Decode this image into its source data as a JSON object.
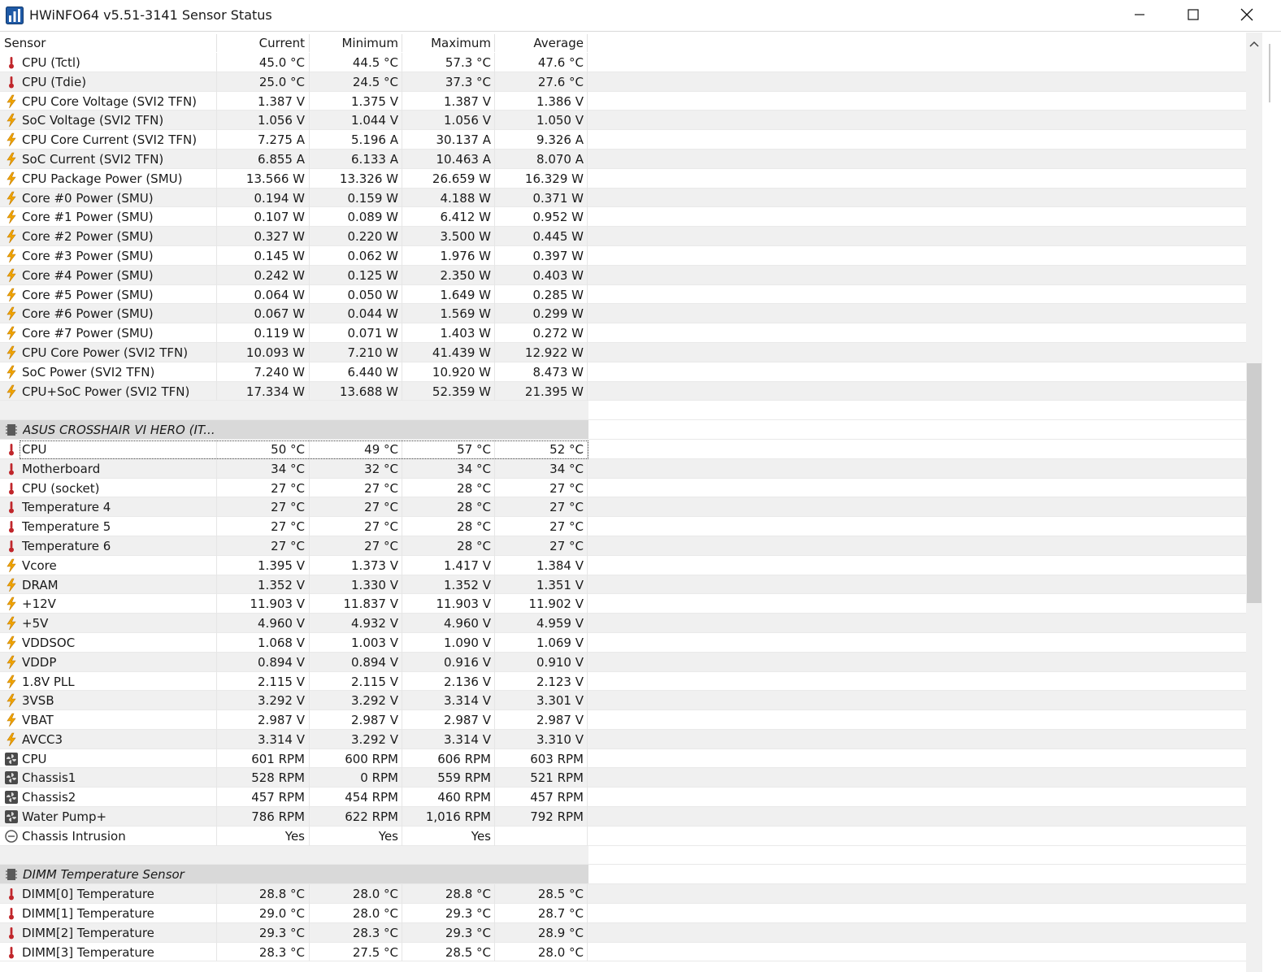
{
  "window": {
    "title": "HWiNFO64 v5.51-3141 Sensor Status",
    "app_icon": "hwinfo-chart-icon",
    "controls": [
      "minimize-icon",
      "maximize-icon",
      "close-icon"
    ]
  },
  "columns": {
    "sensor": "Sensor",
    "current": "Current",
    "minimum": "Minimum",
    "maximum": "Maximum",
    "average": "Average"
  },
  "icons": {
    "temp": {
      "name": "thermometer-icon",
      "color": "#c0262b"
    },
    "volt": {
      "name": "lightning-icon",
      "color": "#f0a400"
    },
    "fan": {
      "name": "fan-icon",
      "color": "#3c3c3c"
    },
    "other": {
      "name": "intrusion-icon",
      "color": "#555555"
    },
    "chip": {
      "name": "chip-icon",
      "color": "#555555"
    }
  },
  "rows": [
    {
      "type": "sensor",
      "icon": "temp",
      "name": "CPU (Tctl)",
      "current": "45.0 °C",
      "minimum": "44.5 °C",
      "maximum": "57.3 °C",
      "average": "47.6 °C"
    },
    {
      "type": "sensor",
      "icon": "temp",
      "name": "CPU (Tdie)",
      "current": "25.0 °C",
      "minimum": "24.5 °C",
      "maximum": "37.3 °C",
      "average": "27.6 °C"
    },
    {
      "type": "sensor",
      "icon": "volt",
      "name": "CPU Core Voltage (SVI2 TFN)",
      "current": "1.387 V",
      "minimum": "1.375 V",
      "maximum": "1.387 V",
      "average": "1.386 V"
    },
    {
      "type": "sensor",
      "icon": "volt",
      "name": "SoC Voltage (SVI2 TFN)",
      "current": "1.056 V",
      "minimum": "1.044 V",
      "maximum": "1.056 V",
      "average": "1.050 V"
    },
    {
      "type": "sensor",
      "icon": "volt",
      "name": "CPU Core Current (SVI2 TFN)",
      "current": "7.275 A",
      "minimum": "5.196 A",
      "maximum": "30.137 A",
      "average": "9.326 A"
    },
    {
      "type": "sensor",
      "icon": "volt",
      "name": "SoC Current (SVI2 TFN)",
      "current": "6.855 A",
      "minimum": "6.133 A",
      "maximum": "10.463 A",
      "average": "8.070 A"
    },
    {
      "type": "sensor",
      "icon": "volt",
      "name": "CPU Package Power (SMU)",
      "current": "13.566 W",
      "minimum": "13.326 W",
      "maximum": "26.659 W",
      "average": "16.329 W"
    },
    {
      "type": "sensor",
      "icon": "volt",
      "name": "Core #0 Power (SMU)",
      "current": "0.194 W",
      "minimum": "0.159 W",
      "maximum": "4.188 W",
      "average": "0.371 W"
    },
    {
      "type": "sensor",
      "icon": "volt",
      "name": "Core #1 Power (SMU)",
      "current": "0.107 W",
      "minimum": "0.089 W",
      "maximum": "6.412 W",
      "average": "0.952 W"
    },
    {
      "type": "sensor",
      "icon": "volt",
      "name": "Core #2 Power (SMU)",
      "current": "0.327 W",
      "minimum": "0.220 W",
      "maximum": "3.500 W",
      "average": "0.445 W"
    },
    {
      "type": "sensor",
      "icon": "volt",
      "name": "Core #3 Power (SMU)",
      "current": "0.145 W",
      "minimum": "0.062 W",
      "maximum": "1.976 W",
      "average": "0.397 W"
    },
    {
      "type": "sensor",
      "icon": "volt",
      "name": "Core #4 Power (SMU)",
      "current": "0.242 W",
      "minimum": "0.125 W",
      "maximum": "2.350 W",
      "average": "0.403 W"
    },
    {
      "type": "sensor",
      "icon": "volt",
      "name": "Core #5 Power (SMU)",
      "current": "0.064 W",
      "minimum": "0.050 W",
      "maximum": "1.649 W",
      "average": "0.285 W"
    },
    {
      "type": "sensor",
      "icon": "volt",
      "name": "Core #6 Power (SMU)",
      "current": "0.067 W",
      "minimum": "0.044 W",
      "maximum": "1.569 W",
      "average": "0.299 W"
    },
    {
      "type": "sensor",
      "icon": "volt",
      "name": "Core #7 Power (SMU)",
      "current": "0.119 W",
      "minimum": "0.071 W",
      "maximum": "1.403 W",
      "average": "0.272 W"
    },
    {
      "type": "sensor",
      "icon": "volt",
      "name": "CPU Core Power (SVI2 TFN)",
      "current": "10.093 W",
      "minimum": "7.210 W",
      "maximum": "41.439 W",
      "average": "12.922 W"
    },
    {
      "type": "sensor",
      "icon": "volt",
      "name": "SoC Power (SVI2 TFN)",
      "current": "7.240 W",
      "minimum": "6.440 W",
      "maximum": "10.920 W",
      "average": "8.473 W"
    },
    {
      "type": "sensor",
      "icon": "volt",
      "name": "CPU+SoC Power (SVI2 TFN)",
      "current": "17.334 W",
      "minimum": "13.688 W",
      "maximum": "52.359 W",
      "average": "21.395 W"
    },
    {
      "type": "blank"
    },
    {
      "type": "group",
      "icon": "chip",
      "name": "ASUS CROSSHAIR VI HERO (IT..."
    },
    {
      "type": "sensor",
      "icon": "temp",
      "name": "CPU",
      "current": "50 °C",
      "minimum": "49 °C",
      "maximum": "57 °C",
      "average": "52 °C",
      "focused": true
    },
    {
      "type": "sensor",
      "icon": "temp",
      "name": "Motherboard",
      "current": "34 °C",
      "minimum": "32 °C",
      "maximum": "34 °C",
      "average": "34 °C"
    },
    {
      "type": "sensor",
      "icon": "temp",
      "name": "CPU (socket)",
      "current": "27 °C",
      "minimum": "27 °C",
      "maximum": "28 °C",
      "average": "27 °C"
    },
    {
      "type": "sensor",
      "icon": "temp",
      "name": "Temperature 4",
      "current": "27 °C",
      "minimum": "27 °C",
      "maximum": "28 °C",
      "average": "27 °C"
    },
    {
      "type": "sensor",
      "icon": "temp",
      "name": "Temperature 5",
      "current": "27 °C",
      "minimum": "27 °C",
      "maximum": "28 °C",
      "average": "27 °C"
    },
    {
      "type": "sensor",
      "icon": "temp",
      "name": "Temperature 6",
      "current": "27 °C",
      "minimum": "27 °C",
      "maximum": "28 °C",
      "average": "27 °C"
    },
    {
      "type": "sensor",
      "icon": "volt",
      "name": "Vcore",
      "current": "1.395 V",
      "minimum": "1.373 V",
      "maximum": "1.417 V",
      "average": "1.384 V"
    },
    {
      "type": "sensor",
      "icon": "volt",
      "name": "DRAM",
      "current": "1.352 V",
      "minimum": "1.330 V",
      "maximum": "1.352 V",
      "average": "1.351 V"
    },
    {
      "type": "sensor",
      "icon": "volt",
      "name": "+12V",
      "current": "11.903 V",
      "minimum": "11.837 V",
      "maximum": "11.903 V",
      "average": "11.902 V"
    },
    {
      "type": "sensor",
      "icon": "volt",
      "name": "+5V",
      "current": "4.960 V",
      "minimum": "4.932 V",
      "maximum": "4.960 V",
      "average": "4.959 V"
    },
    {
      "type": "sensor",
      "icon": "volt",
      "name": "VDDSOC",
      "current": "1.068 V",
      "minimum": "1.003 V",
      "maximum": "1.090 V",
      "average": "1.069 V"
    },
    {
      "type": "sensor",
      "icon": "volt",
      "name": "VDDP",
      "current": "0.894 V",
      "minimum": "0.894 V",
      "maximum": "0.916 V",
      "average": "0.910 V"
    },
    {
      "type": "sensor",
      "icon": "volt",
      "name": "1.8V PLL",
      "current": "2.115 V",
      "minimum": "2.115 V",
      "maximum": "2.136 V",
      "average": "2.123 V"
    },
    {
      "type": "sensor",
      "icon": "volt",
      "name": "3VSB",
      "current": "3.292 V",
      "minimum": "3.292 V",
      "maximum": "3.314 V",
      "average": "3.301 V"
    },
    {
      "type": "sensor",
      "icon": "volt",
      "name": "VBAT",
      "current": "2.987 V",
      "minimum": "2.987 V",
      "maximum": "2.987 V",
      "average": "2.987 V"
    },
    {
      "type": "sensor",
      "icon": "volt",
      "name": "AVCC3",
      "current": "3.314 V",
      "minimum": "3.292 V",
      "maximum": "3.314 V",
      "average": "3.310 V"
    },
    {
      "type": "sensor",
      "icon": "fan",
      "name": "CPU",
      "current": "601 RPM",
      "minimum": "600 RPM",
      "maximum": "606 RPM",
      "average": "603 RPM"
    },
    {
      "type": "sensor",
      "icon": "fan",
      "name": "Chassis1",
      "current": "528 RPM",
      "minimum": "0 RPM",
      "maximum": "559 RPM",
      "average": "521 RPM"
    },
    {
      "type": "sensor",
      "icon": "fan",
      "name": "Chassis2",
      "current": "457 RPM",
      "minimum": "454 RPM",
      "maximum": "460 RPM",
      "average": "457 RPM"
    },
    {
      "type": "sensor",
      "icon": "fan",
      "name": "Water Pump+",
      "current": "786 RPM",
      "minimum": "622 RPM",
      "maximum": "1,016 RPM",
      "average": "792 RPM"
    },
    {
      "type": "sensor",
      "icon": "other",
      "name": "Chassis Intrusion",
      "current": "Yes",
      "minimum": "Yes",
      "maximum": "Yes",
      "average": ""
    },
    {
      "type": "blank"
    },
    {
      "type": "group",
      "icon": "chip",
      "name": "DIMM Temperature Sensor"
    },
    {
      "type": "sensor",
      "icon": "temp",
      "name": "DIMM[0] Temperature",
      "current": "28.8 °C",
      "minimum": "28.0 °C",
      "maximum": "28.8 °C",
      "average": "28.5 °C"
    },
    {
      "type": "sensor",
      "icon": "temp",
      "name": "DIMM[1] Temperature",
      "current": "29.0 °C",
      "minimum": "28.0 °C",
      "maximum": "29.3 °C",
      "average": "28.7 °C"
    },
    {
      "type": "sensor",
      "icon": "temp",
      "name": "DIMM[2] Temperature",
      "current": "29.3 °C",
      "minimum": "28.3 °C",
      "maximum": "29.3 °C",
      "average": "28.9 °C"
    },
    {
      "type": "sensor",
      "icon": "temp",
      "name": "DIMM[3] Temperature",
      "current": "28.3 °C",
      "minimum": "27.5 °C",
      "maximum": "28.5 °C",
      "average": "28.0 °C"
    }
  ],
  "scrollbar": {
    "up_icon": "chevron-up-icon",
    "position": 0.35,
    "visible_fraction": 0.26
  }
}
